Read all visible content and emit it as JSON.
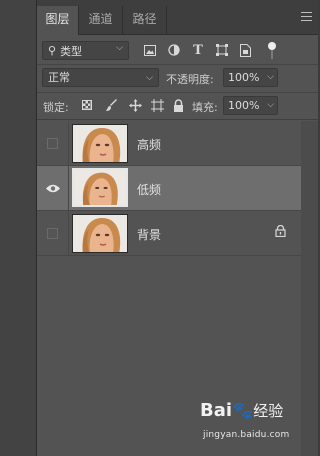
{
  "tabs": [
    {
      "label": "图层",
      "active": true
    },
    {
      "label": "通道",
      "active": false
    },
    {
      "label": "路径",
      "active": false
    }
  ],
  "panel_menu_icon": "hamburger-menu-icon",
  "filter": {
    "kind_icon": "search-icon",
    "kind_label": "类型",
    "icons": [
      "pixel-layer-filter-icon",
      "adjustment-layer-filter-icon",
      "type-layer-filter-icon",
      "shape-layer-filter-icon",
      "smart-object-filter-icon"
    ],
    "toggle": "filter-on-off-toggle"
  },
  "blend": {
    "mode": "正常",
    "opacity_label": "不透明度:",
    "opacity_value": "100%"
  },
  "lock": {
    "label": "锁定:",
    "icons": [
      "lock-transparent-pixels-icon",
      "lock-image-pixels-icon",
      "lock-position-icon",
      "lock-artboard-icon",
      "lock-all-icon"
    ],
    "fill_label": "填充:",
    "fill_value": "100%"
  },
  "layers": [
    {
      "name": "高频",
      "visible": false,
      "selected": false,
      "locked": false
    },
    {
      "name": "低频",
      "visible": true,
      "selected": true,
      "locked": false
    },
    {
      "name": "背景",
      "visible": false,
      "selected": false,
      "locked": true
    }
  ],
  "watermark": {
    "logo": "Bai",
    "logo_tail": "经验",
    "url": "jingyan.baidu.com"
  }
}
